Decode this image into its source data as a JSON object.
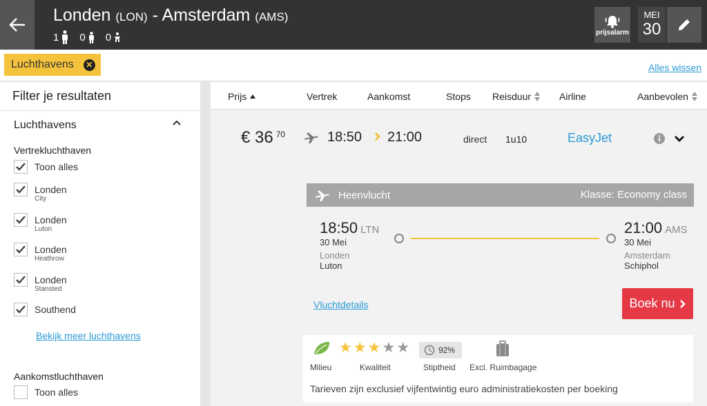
{
  "header": {
    "origin_city": "Londen",
    "origin_code": "(LON)",
    "separator": "-",
    "destination_city": "Amsterdam",
    "destination_code": "(AMS)",
    "passengers": {
      "adults": "1",
      "children": "0",
      "infants": "0"
    },
    "alarm_label": "prijsalarm",
    "date_month": "MEI",
    "date_day": "30"
  },
  "filters_bar": {
    "chip_label": "Luchthavens",
    "clear_all": "Alles wissen"
  },
  "sidebar": {
    "title": "Filter je resultaten",
    "section": "Luchthavens",
    "departure_heading": "Vertrekluchthaven",
    "departure_items": [
      {
        "label": "Toon alles",
        "sub": "",
        "checked": true
      },
      {
        "label": "Londen",
        "sub": "City",
        "checked": true
      },
      {
        "label": "Londen",
        "sub": "Luton",
        "checked": true
      },
      {
        "label": "Londen",
        "sub": "Heathrow",
        "checked": true
      },
      {
        "label": "Londen",
        "sub": "Stansted",
        "checked": true
      },
      {
        "label": "Southend",
        "sub": "",
        "checked": true
      }
    ],
    "more_link": "Bekijk meer luchthavens",
    "arrival_heading": "Aankomstluchthaven",
    "arrival_items": [
      {
        "label": "Toon alles",
        "checked": false
      }
    ]
  },
  "sort": {
    "price": "Prijs",
    "departure": "Vertrek",
    "arrival": "Aankomst",
    "stops": "Stops",
    "duration": "Reisduur",
    "airline": "Airline",
    "recommended": "Aanbevolen"
  },
  "result": {
    "price_main": "€ 36",
    "price_cents": "70",
    "dep_time": "18:50",
    "arr_time": "21:00",
    "stops": "direct",
    "duration": "1u10",
    "airline": "EasyJet",
    "outbound": {
      "label": "Heenvlucht",
      "class": "Klasse: Economy class",
      "dep_time": "18:50",
      "dep_code": "LTN",
      "dep_date": "30 Mei",
      "dep_city": "Londen",
      "dep_airport": "Luton",
      "arr_time": "21:00",
      "arr_code": "AMS",
      "arr_date": "30 Mei",
      "arr_city": "Amsterdam",
      "arr_airport": "Schiphol"
    },
    "details_link": "Vluchtdetails",
    "book_label": "Boek nu",
    "ratings": {
      "environment": "Milieu",
      "quality": "Kwaliteit",
      "quality_stars": 3,
      "quality_max": 5,
      "punctuality_value": "92%",
      "punctuality": "Stiptheid",
      "baggage": "Excl. Ruimbagage"
    },
    "footnote": "Tarieven zijn exclusief vijfentwintig euro administratiekosten per boeking"
  },
  "colors": {
    "accent_yellow": "#f5c33b",
    "link_blue": "#2a9ad6",
    "book_red": "#e63946",
    "header_dark": "#333333"
  }
}
